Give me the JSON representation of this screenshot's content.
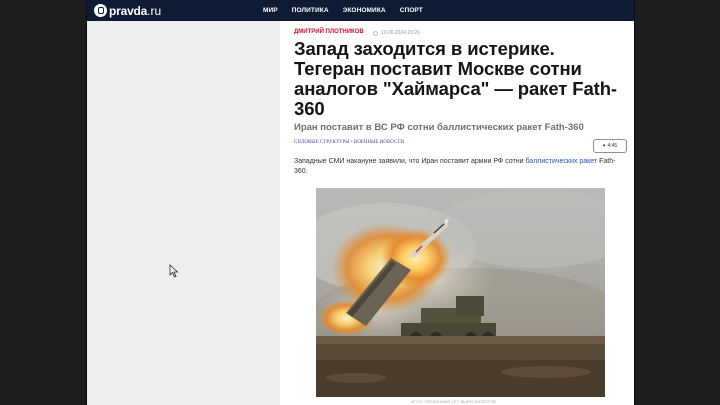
{
  "header": {
    "logo_name": "pravda",
    "logo_tld": ".ru",
    "nav": [
      "МИР",
      "ПОЛИТИКА",
      "ЭКОНОМИКА",
      "СПОРТ"
    ]
  },
  "article": {
    "author": "ДМИТРИЙ ПЛОТНИКОВ",
    "date": "10.06.2024 20:26",
    "title": "Запад заходится в истерике. Тегеран поставит Москве сотни аналогов \"Хаймарса\" — ракет Fath-360",
    "subtitle": "Иран поставит в ВС РФ сотни баллистических ракет Fath-360",
    "tags": "СИЛОВЫЕ СТРУКТУРЫ • ВОЕННЫЕ НОВОСТИ",
    "listen_label": "4:45",
    "lead_before": "Западные СМИ накануне заявили, что Иран поставит армии РФ сотни ",
    "lead_link": "баллистических ракет",
    "lead_after": " Fath-360.",
    "photo_caption": "ФОТО: ПУБЛИЧНЫЙ СЕТ ВЫПУСКИЗГОТОВ"
  },
  "icons": {
    "logo": "pravda-logo-icon",
    "clock": "clock-icon",
    "speaker": "speaker-icon",
    "cursor": "mouse-cursor-icon"
  },
  "colors": {
    "header_bg": "#0e1b35",
    "author_red": "#c8102e",
    "link_blue": "#2c4fb8"
  }
}
